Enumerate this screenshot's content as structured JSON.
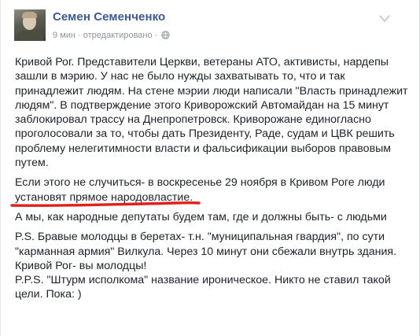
{
  "post": {
    "author": "Семен Семенченко",
    "time": "9 мин",
    "edited": "отредактировано",
    "separator": "·",
    "paragraphs": [
      "Кривой Рог. Представители Церкви, ветераны АТО, активисты, нардепы зашли в мэрию. У нас не было нужды захватывать то, что и так принадлежит людям. На стене мэрии люди написали \"Власть принадлежит людям\". В подтверждение этого Криворожский Автомайдан на 15 минут заблокировал трассу на Днепропетровск. Криворожане единогласно проголосовали за то, чтобы дать Президенту, Раде, судам и ЦВК решить проблему нелегитимности власти и фальсификации выборов правовым путем.",
      "Если этого не случиться- в воскресенье 29 ноября в Кривом Роге люди установят прямое народовластие.",
      "А мы, как народные депутаты будем там, где и должны быть- с людьми",
      "P.S. Бравые молодцы в беретах- т.н. \"муниципальная гвардия\", по сути \"карманная армия\" Вилкула. Через 10 минут они сбежали внутрь здания. Кривой Рог- вы молодцы!",
      "P.P.S. \"Штурм исполкома\" название ироническое. Никто не ставил такой цели. Пока: )"
    ]
  },
  "icons": {
    "globe": "globe-icon",
    "options": "chevron-down-icon"
  },
  "colors": {
    "author": "#3b5998",
    "body_text": "#1d2129",
    "meta_text": "#90949c",
    "underline_annotation": "#e0201b"
  }
}
